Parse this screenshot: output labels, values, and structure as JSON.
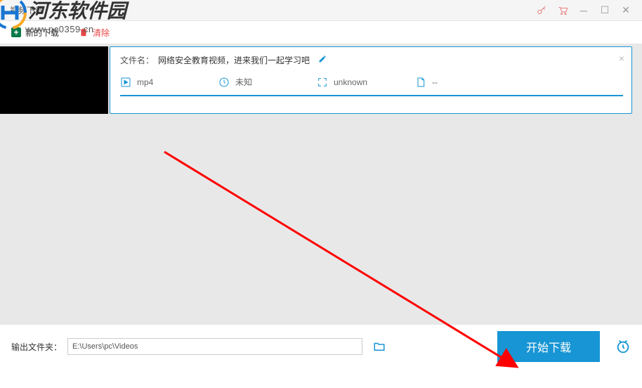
{
  "window": {
    "title": "视频下载"
  },
  "toolbar": {
    "new_download": "新的下载",
    "clear": "清除"
  },
  "item": {
    "filename_label": "文件名：",
    "filename": "网络安全教育视频，进来我们一起学习吧",
    "format": "mp4",
    "duration": "未知",
    "resolution": "unknown",
    "size": "--"
  },
  "output": {
    "label": "输出文件夹：",
    "path": "E:\\Users\\pc\\Videos"
  },
  "actions": {
    "start_download": "开始下载"
  },
  "watermark": {
    "brand": "河东软件园",
    "url": "www.pc0359.cn"
  }
}
